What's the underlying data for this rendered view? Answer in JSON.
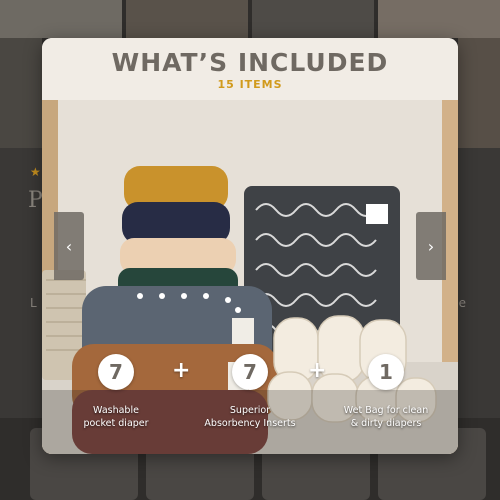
{
  "modal": {
    "title": "WHAT’S INCLUDED",
    "subtitle": "15 ITEMS"
  },
  "items": [
    {
      "count": "7",
      "label_line1": "Washable",
      "label_line2": "pocket diaper"
    },
    {
      "count": "7",
      "label_line1": "Superior",
      "label_line2": "Absorbency Inserts"
    },
    {
      "count": "1",
      "label_line1": "Wet Bag for clean",
      "label_line2": "& dirty diapers"
    }
  ],
  "separators": [
    "+",
    "+"
  ],
  "nav": {
    "prev_icon": "‹",
    "next_icon": "›"
  },
  "colors": {
    "accent": "#d19a1c",
    "title": "#6f6962",
    "overlay": "#2f2d2b"
  }
}
